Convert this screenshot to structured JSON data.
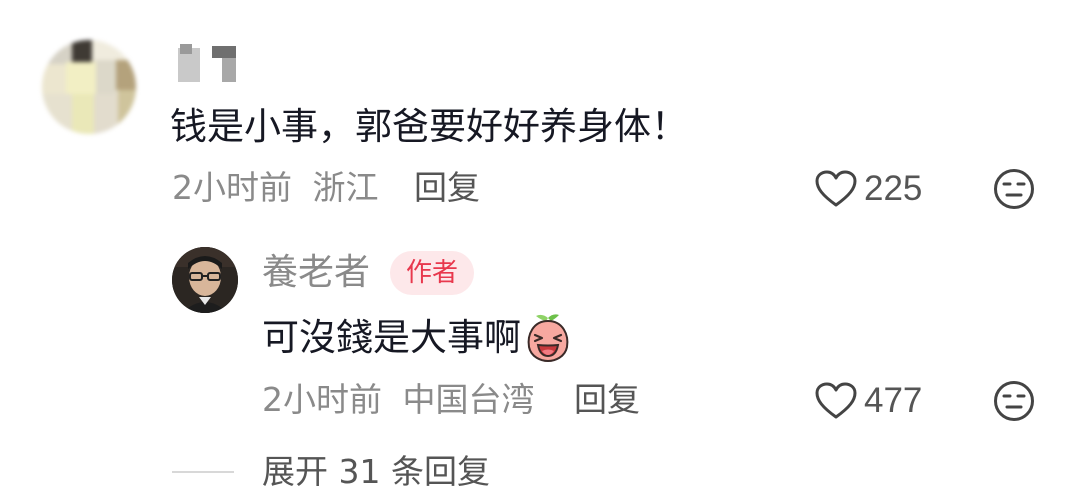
{
  "comment": {
    "text": "钱是小事，郭爸要好好养身体！",
    "time": "2小时前",
    "location": "浙江",
    "reply_label": "回复",
    "likes": "225"
  },
  "reply": {
    "username": "養老者",
    "badge": "作者",
    "text": "可沒錢是大事啊",
    "time": "2小时前",
    "location": "中国台湾",
    "reply_label": "回复",
    "likes": "477"
  },
  "expand": {
    "label": "展开 31 条回复"
  },
  "colors": {
    "text": "#161823",
    "meta": "#8a8a8a",
    "badge_bg": "#fde8ea",
    "badge_text": "#e8384d"
  },
  "icons": {
    "like": "heart-outline-icon",
    "dislike": "neutral-face-icon",
    "emoji": "laughing-peach-emoji-icon"
  }
}
